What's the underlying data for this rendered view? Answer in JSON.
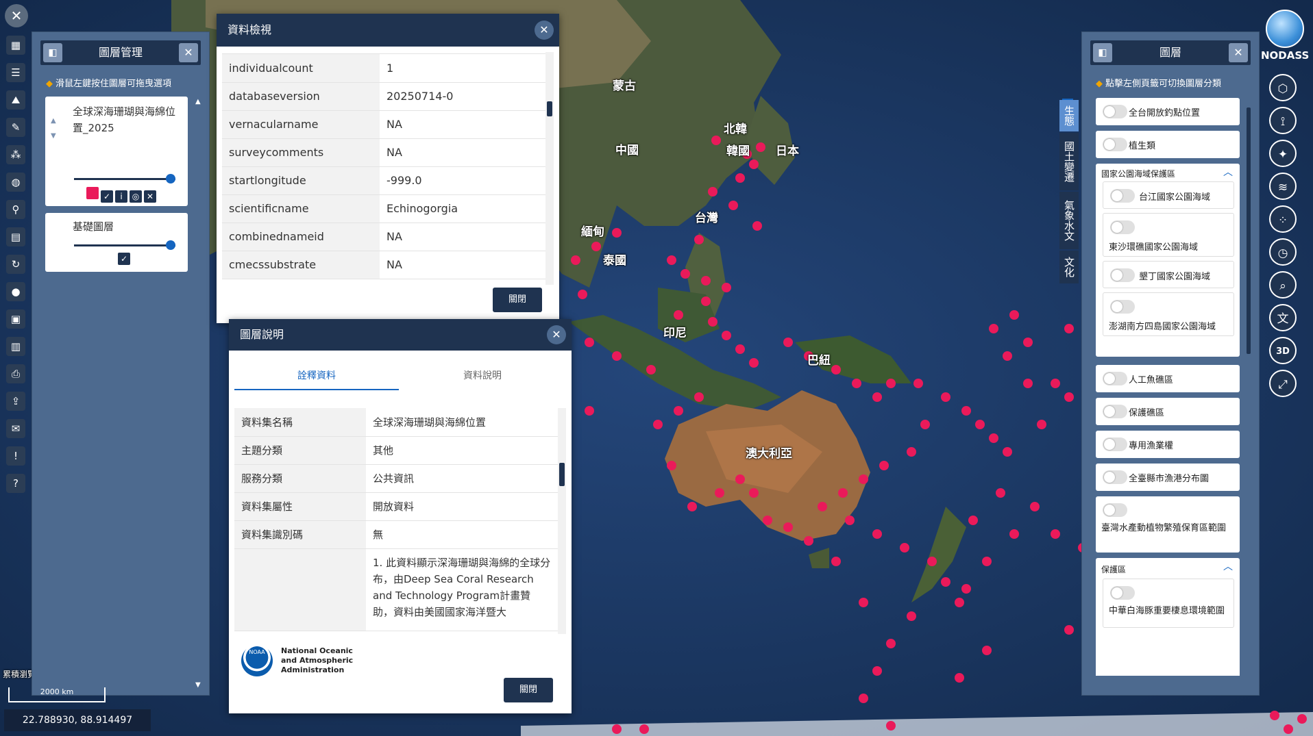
{
  "map": {
    "labels": [
      "蒙古",
      "北韓",
      "韓國",
      "日本",
      "中國",
      "台灣",
      "緬甸",
      "泰國",
      "印尼",
      "巴紐",
      "澳大利亞"
    ],
    "dot_color": "#ea1a5a",
    "coordinates": "22.788930, 88.914497",
    "scale_text": "2000 km",
    "edge_fragments": [
      "累積瀏覽"
    ]
  },
  "left_toolbar": {
    "icons": [
      "close-icon",
      "map-icon",
      "list-icon",
      "layers-stack-icon",
      "measure-icon",
      "chart-icon",
      "globe-icon",
      "location-pin-icon",
      "grid-icon",
      "refresh-icon",
      "user-icon",
      "window-icon",
      "book-icon",
      "print-icon",
      "export-icon",
      "chat-icon",
      "alert-icon",
      "help-icon"
    ]
  },
  "layer_manager": {
    "title": "圖層管理",
    "hint": "滑鼠左鍵按住圖層可拖曳選項",
    "layers": [
      {
        "name": "全球深海珊瑚與海綿位置_2025",
        "opacity": 1
      },
      {
        "name": "基礎圖層",
        "opacity": 1
      }
    ]
  },
  "data_view": {
    "title": "資料檢視",
    "rows": [
      {
        "key": "individualcount",
        "value": "1"
      },
      {
        "key": "databaseversion",
        "value": "20250714-0"
      },
      {
        "key": "vernacularname",
        "value": "NA"
      },
      {
        "key": "surveycomments",
        "value": "NA"
      },
      {
        "key": "startlongitude",
        "value": "-999.0"
      },
      {
        "key": "scientificname",
        "value": "Echinogorgia"
      },
      {
        "key": "combinednameid",
        "value": "NA"
      },
      {
        "key": "cmecssubstrate",
        "value": "NA"
      }
    ],
    "close_label": "關閉"
  },
  "layer_info": {
    "title": "圖層說明",
    "tabs": [
      "詮釋資料",
      "資料說明"
    ],
    "rows": [
      {
        "key": "資料集名稱",
        "value": "全球深海珊瑚與海綿位置"
      },
      {
        "key": "主題分類",
        "value": "其他"
      },
      {
        "key": "服務分類",
        "value": "公共資訊"
      },
      {
        "key": "資料集屬性",
        "value": "開放資料"
      },
      {
        "key": "資料集識別碼",
        "value": "無"
      },
      {
        "key": "",
        "value": "1. 此資料顯示深海珊瑚與海綿的全球分布，由Deep Sea Coral Research and Technology Program計畫贊助，資料由美國國家海洋暨大"
      }
    ],
    "logo_text": [
      "National Oceanic",
      "and Atmospheric",
      "Administration"
    ],
    "logo_badge": "NOAA",
    "close_label": "關閉"
  },
  "layers_panel": {
    "title": "圖層",
    "hint": "點擊左側頁籤可切換圖層分類",
    "vertical_tabs": [
      "生態",
      "國土變遷",
      "氣象水文",
      "文化"
    ],
    "items": [
      {
        "type": "toggle",
        "label": "全台開放釣點位置"
      },
      {
        "type": "toggle",
        "label": "植生類"
      },
      {
        "type": "group",
        "label": "國家公園海域保護區"
      },
      {
        "type": "toggle",
        "label": "台江國家公園海域"
      },
      {
        "type": "toggle",
        "label": "東沙環礁國家公園海域"
      },
      {
        "type": "toggle",
        "label": "墾丁國家公園海域"
      },
      {
        "type": "toggle",
        "label": "澎湖南方四島國家公園海域"
      },
      {
        "type": "toggle",
        "label": "人工魚礁區"
      },
      {
        "type": "toggle",
        "label": "保護礁區"
      },
      {
        "type": "toggle",
        "label": "專用漁業權"
      },
      {
        "type": "toggle",
        "label": "全臺縣市漁港分布圖"
      },
      {
        "type": "toggle",
        "label": "臺灣水產動植物繁殖保育區範圍"
      },
      {
        "type": "group",
        "label": "保護區"
      },
      {
        "type": "toggle",
        "label": "中華白海豚重要棲息環境範圍"
      }
    ]
  },
  "right_toolbar": {
    "logo": "NODASS",
    "icons": [
      "cube-icon",
      "satellite-icon",
      "satellite-dish-icon",
      "layers-icon",
      "pins-icon",
      "clock-icon",
      "search-icon",
      "translate-icon",
      "3d-icon",
      "fullscreen-icon"
    ],
    "label_3d": "3D"
  }
}
